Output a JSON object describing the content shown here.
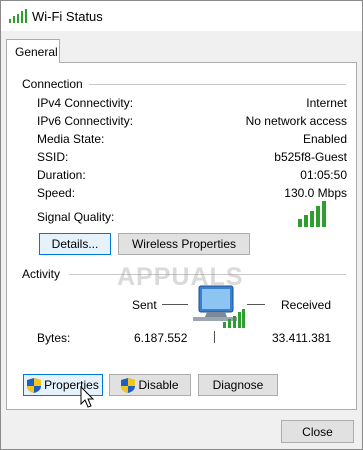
{
  "window": {
    "title": "Wi-Fi Status",
    "icon": "wifi-signal-icon"
  },
  "tabs": [
    {
      "label": "General",
      "selected": true
    }
  ],
  "connection": {
    "group_label": "Connection",
    "rows": [
      {
        "label": "IPv4 Connectivity:",
        "value": "Internet"
      },
      {
        "label": "IPv6 Connectivity:",
        "value": "No network access"
      },
      {
        "label": "Media State:",
        "value": "Enabled"
      },
      {
        "label": "SSID:",
        "value": "b525f8-Guest"
      },
      {
        "label": "Duration:",
        "value": "01:05:50"
      },
      {
        "label": "Speed:",
        "value": "130.0 Mbps"
      }
    ],
    "signal_quality_label": "Signal Quality:",
    "signal_bars_lit": 5,
    "signal_bars_total": 5,
    "details_button": "Details...",
    "wireless_properties_button": "Wireless Properties"
  },
  "activity": {
    "group_label": "Activity",
    "sent_label": "Sent",
    "received_label": "Received",
    "bytes_label": "Bytes:",
    "bytes_sent": "6.187.552",
    "bytes_received": "33.411.381",
    "properties_button": "Properties",
    "disable_button": "Disable",
    "diagnose_button": "Diagnose"
  },
  "close_button": "Close",
  "watermark": "APPUALS",
  "colors": {
    "signal_green": "#2e9e2e",
    "focus_blue": "#0078d7",
    "shield_blue": "#1f5fbf",
    "shield_yellow": "#f5c518"
  }
}
